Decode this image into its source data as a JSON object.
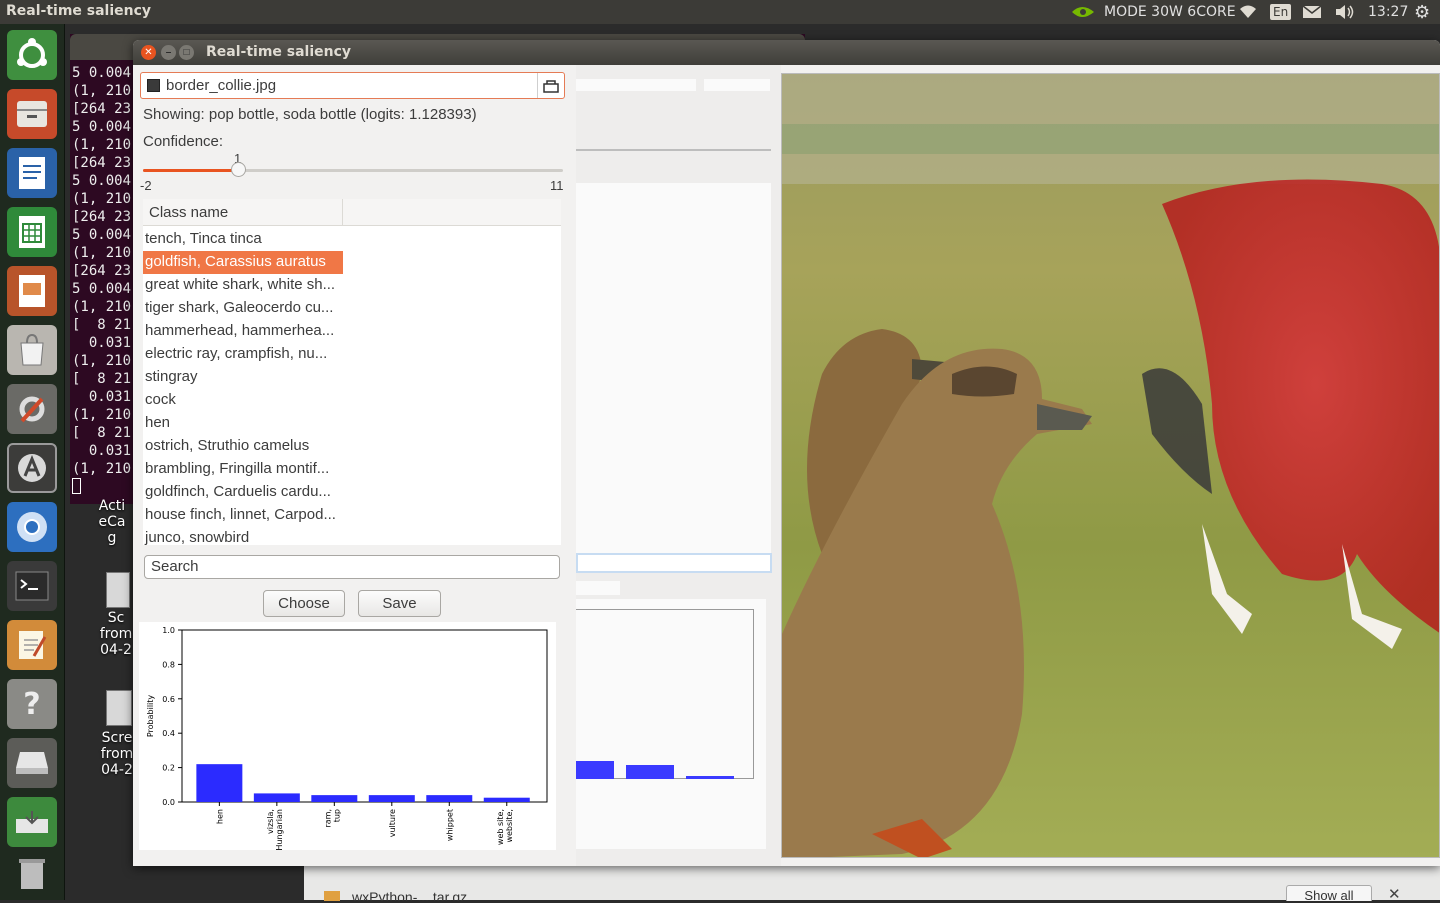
{
  "top_panel": {
    "app_title": "Real-time saliency",
    "power_mode": "MODE 30W 6CORE",
    "keyboard": "En",
    "clock": "13:27"
  },
  "terminal": {
    "lines": [
      "5 0.004",
      "(1, 210",
      "[264 23",
      "5 0.004",
      "(1, 210",
      "[264 23",
      "5 0.004",
      "(1, 210",
      "[264 23",
      "5 0.004",
      "(1, 210",
      "[264 23",
      "5 0.004",
      "(1, 210",
      "[  8 21",
      "  0.031",
      "(1, 210",
      "[  8 21",
      "  0.031",
      "(1, 210",
      "[  8 21",
      "  0.031",
      "(1, 210"
    ]
  },
  "desktop": {
    "file1_line1": "Acti",
    "file1_line2": "eCa",
    "file1_line3": "g",
    "file2_line1": "Sc",
    "file2_line2": "from",
    "file2_line3": "04-2",
    "file3_line1": "Scre",
    "file3_line2": "from",
    "file3_line3": "04-2"
  },
  "window": {
    "title": "Real-time saliency",
    "file_name": "border_collie.jpg",
    "showing": "Showing: pop bottle, soda bottle (logits: 1.128393)",
    "confidence_label": "Confidence:",
    "slider": {
      "value": "1",
      "min": "-2",
      "max": "11",
      "level": 0.23
    },
    "class_header": "Class name",
    "classes": [
      "tench, Tinca tinca",
      "goldfish, Carassius auratus",
      "great white shark, white sh...",
      "tiger shark, Galeocerdo cu...",
      "hammerhead, hammerhea...",
      "electric ray, crampfish, nu...",
      "stingray",
      "cock",
      "hen",
      "ostrich, Struthio camelus",
      "brambling, Fringilla montif...",
      "goldfinch, Carduelis cardu...",
      "house finch, linnet, Carpod...",
      "junco, snowbird"
    ],
    "selected_index": 1,
    "search_value": "Search",
    "choose_label": "Choose",
    "save_label": "Save"
  },
  "chart_data": {
    "type": "bar",
    "categories": [
      "hen",
      "vizsla, Hungarian",
      "ram, tup",
      "vulture",
      "whippet",
      "web site, website,"
    ],
    "values": [
      0.22,
      0.05,
      0.04,
      0.04,
      0.04,
      0.025
    ],
    "ylabel": "Probability",
    "ylim": [
      0,
      1.0
    ],
    "yticks": [
      "0.0",
      "0.2",
      "0.4",
      "0.6",
      "0.8",
      "1.0"
    ],
    "bar_color": "#2b2bff"
  },
  "bottom_strip": {
    "download_label": "wxPython-....tar.gz",
    "show_all_label": "Show all"
  },
  "colors": {
    "accent": "#e95420",
    "selection": "#f07746"
  }
}
